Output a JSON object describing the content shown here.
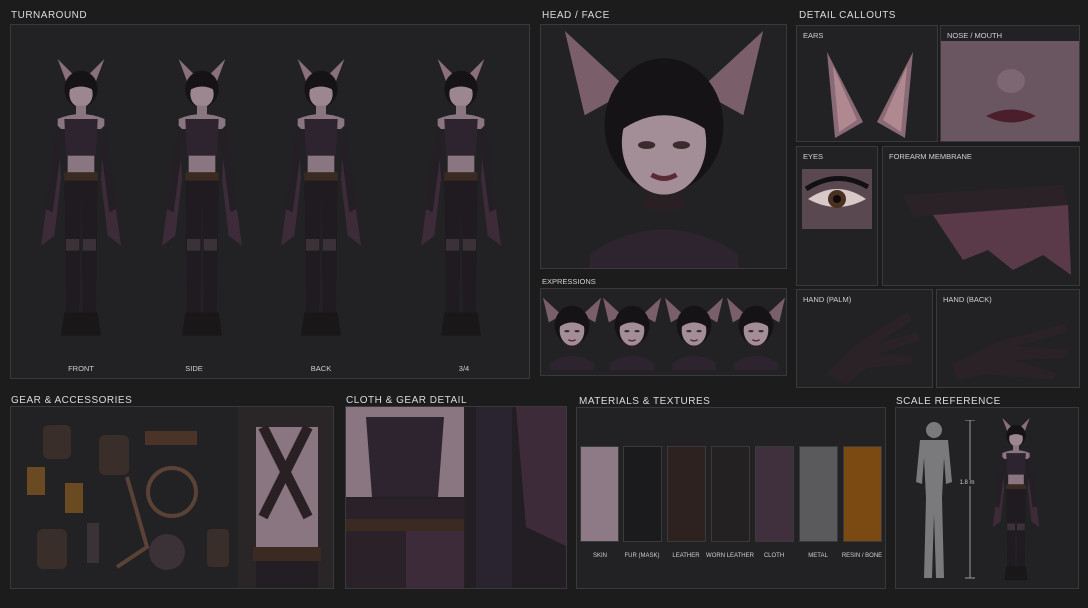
{
  "sections": {
    "turnaround": "TURNAROUND",
    "head_face": "HEAD / FACE",
    "detail_callouts": "DETAIL CALLOUTS",
    "expressions": "EXPRESSIONS",
    "gear": "GEAR & ACCESSORIES",
    "cloth": "CLOTH & GEAR DETAIL",
    "materials": "MATERIALS & TEXTURES",
    "scale": "SCALE REFERENCE"
  },
  "views": [
    "FRONT",
    "SIDE",
    "BACK",
    "3/4"
  ],
  "callouts": {
    "ears": "EARS",
    "nose_mouth": "NOSE / MOUTH",
    "eyes": "EYES",
    "forearm": "FOREARM MEMBRANE",
    "hand_palm": "HAND (PALM)",
    "hand_back": "HAND (BACK)"
  },
  "materials": [
    {
      "label": "SKIN",
      "color": "#8e7a86"
    },
    {
      "label": "FUR (MASK)",
      "color": "#1b1a1c"
    },
    {
      "label": "LEATHER",
      "color": "#2e2220"
    },
    {
      "label": "WORN LEATHER",
      "color": "#232122"
    },
    {
      "label": "CLOTH",
      "color": "#40303d"
    },
    {
      "label": "METAL",
      "color": "#5a5a5c"
    },
    {
      "label": "RESIN / BONE",
      "color": "#7a4a12"
    }
  ],
  "scale_label": "1.8 m",
  "colors": {
    "background": "#1c1c1d",
    "panel": "#222224",
    "border": "#3a3a3c",
    "skin": "#8a7680",
    "leather": "#2a2228",
    "cloth": "#3d2b3a",
    "hair": "#141214"
  }
}
